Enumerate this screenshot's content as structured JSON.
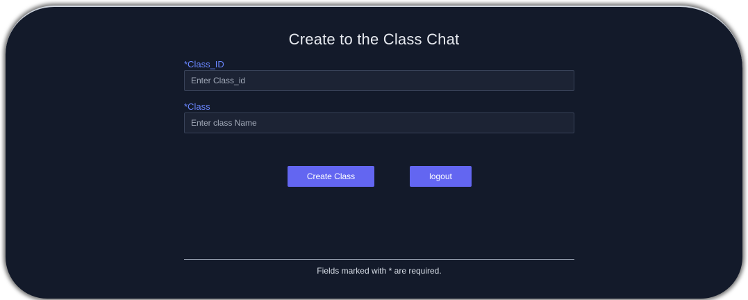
{
  "page": {
    "title": "Create to the Class Chat"
  },
  "form": {
    "class_id": {
      "label": "*Class_ID",
      "placeholder": "Enter Class_id",
      "value": ""
    },
    "class_name": {
      "label": "*Class",
      "placeholder": "Enter class Name",
      "value": ""
    }
  },
  "buttons": {
    "create_label": "Create Class",
    "logout_label": "logout"
  },
  "footer": {
    "note": "Fields marked with * are required."
  },
  "colors": {
    "background": "#131a2a",
    "label": "#6a86ff",
    "button": "#6366f1",
    "input_bg": "#1c2334"
  }
}
